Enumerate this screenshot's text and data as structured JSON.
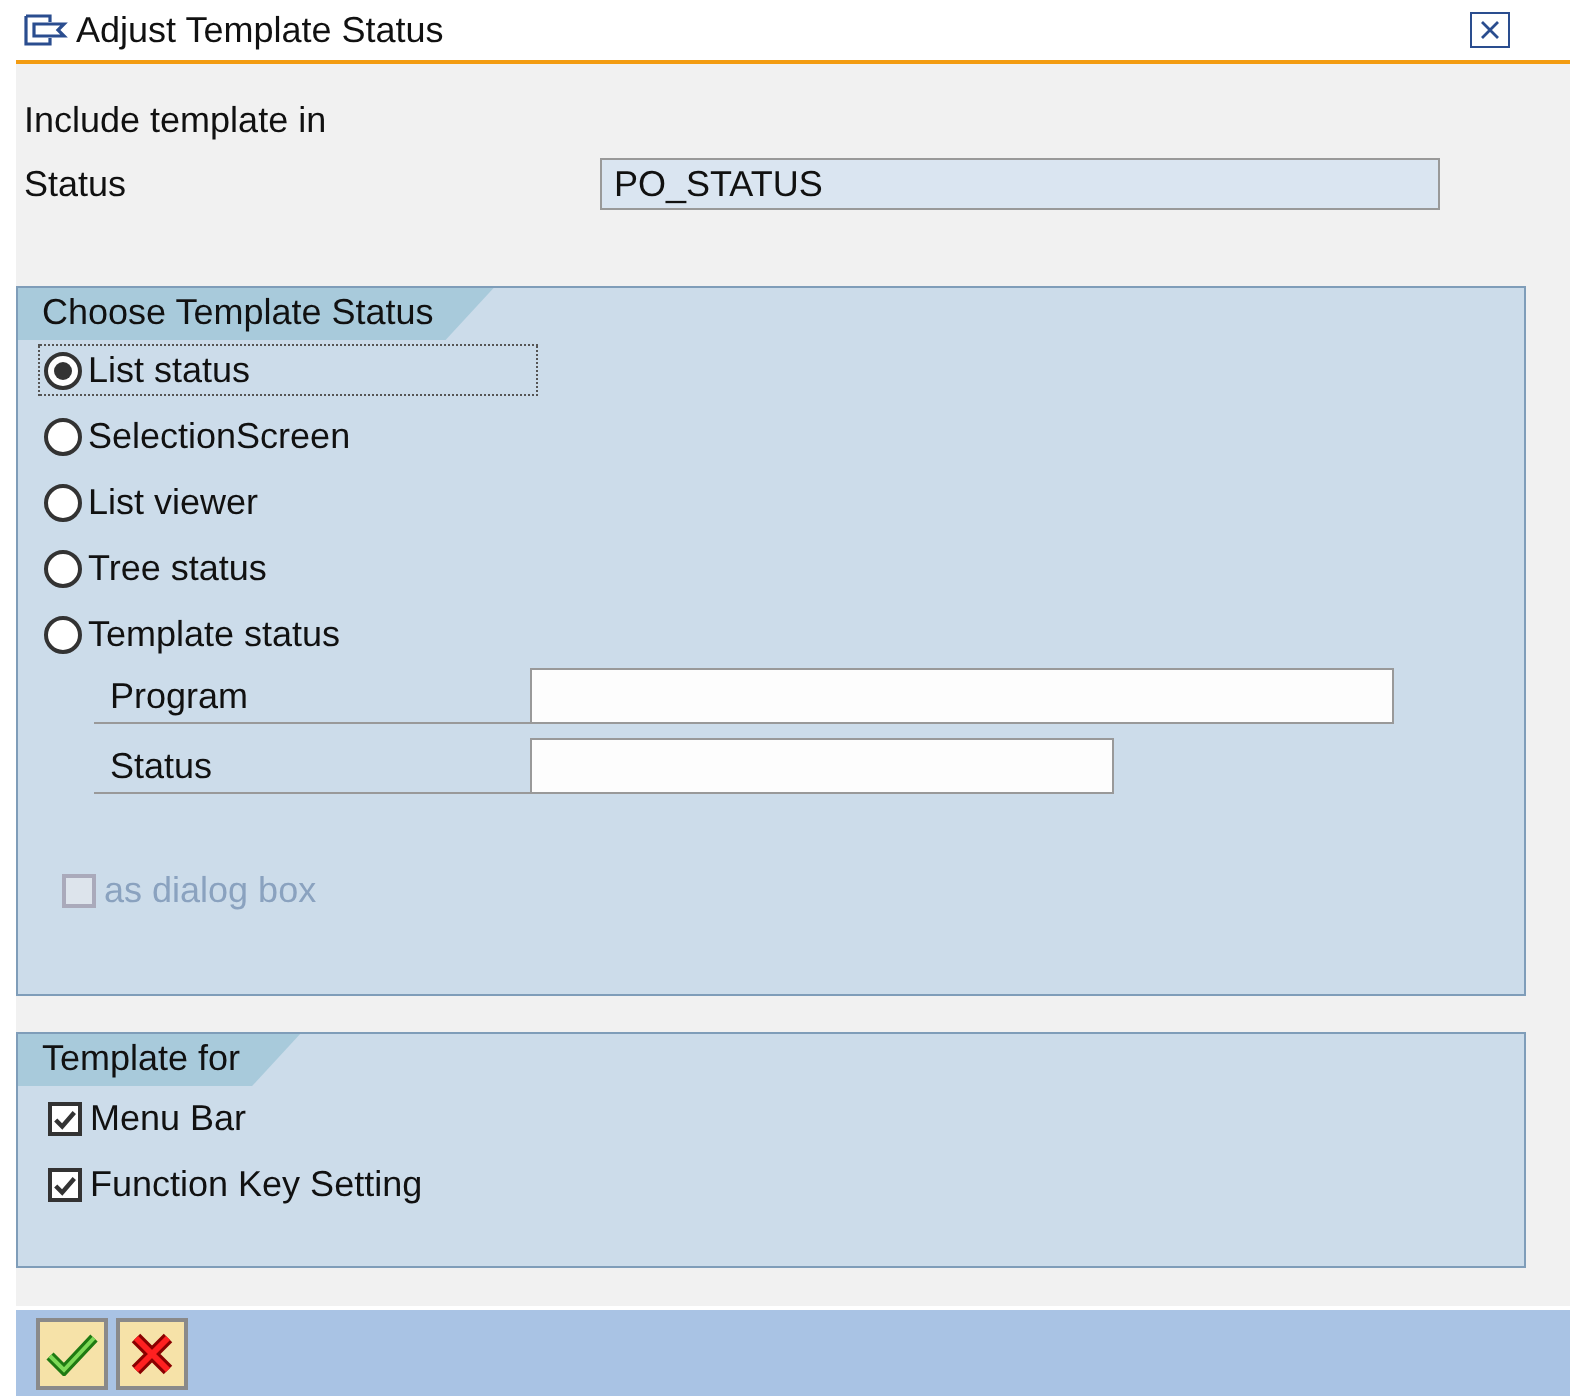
{
  "window": {
    "title": "Adjust Template Status"
  },
  "include_label": "Include template in",
  "status_field": {
    "label": "Status",
    "value": "PO_STATUS"
  },
  "choose_group": {
    "title": "Choose Template Status",
    "options": [
      {
        "label": "List status",
        "selected": true
      },
      {
        "label": "SelectionScreen",
        "selected": false
      },
      {
        "label": "List viewer",
        "selected": false
      },
      {
        "label": "Tree status",
        "selected": false
      },
      {
        "label": "Template status",
        "selected": false
      }
    ],
    "fields": [
      {
        "label": "Program"
      },
      {
        "label": "Status"
      }
    ],
    "dialog_box": {
      "label": "as dialog box",
      "checked": false,
      "disabled": true
    }
  },
  "template_for": {
    "title": "Template for",
    "items": [
      {
        "label": "Menu Bar",
        "checked": true
      },
      {
        "label": "Function Key Setting",
        "checked": true
      }
    ]
  },
  "buttons": [
    {
      "kind": "confirm"
    },
    {
      "kind": "cancel"
    }
  ]
}
